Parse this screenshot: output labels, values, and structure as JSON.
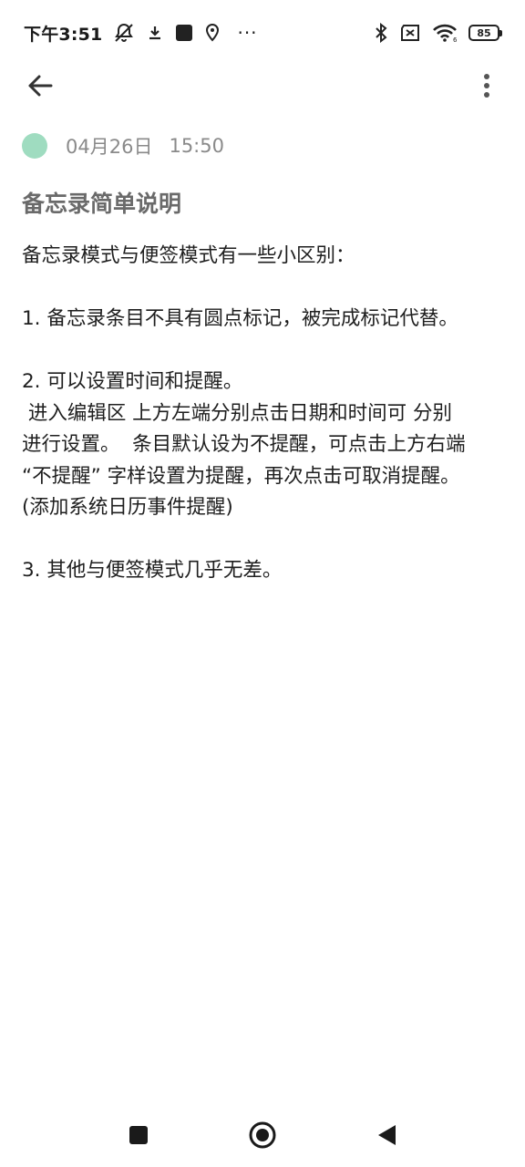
{
  "status_bar": {
    "time": "下午3:51",
    "battery_level": "85",
    "icons": [
      "notifications-off-icon",
      "download-icon",
      "square-icon",
      "location-icon",
      "more-dots-icon",
      "bluetooth-icon",
      "sim-off-icon",
      "wifi-icon",
      "battery-icon"
    ],
    "more": "···"
  },
  "toolbar": {
    "back_icon": "arrow-left-icon",
    "menu_icon": "more-vertical-icon"
  },
  "meta": {
    "color": "#9fdcc0",
    "date": "04月26日",
    "time": "15:50"
  },
  "note": {
    "title": "备忘录简单说明",
    "lines": [
      "备忘录模式与便签模式有一些小区别：",
      "",
      "1. 备忘录条目不具有圆点标记，被完成标记代替。",
      "",
      "2. 可以设置时间和提醒。",
      " 进入编辑区 上方左端分别点击日期和时间可 分别",
      "进行设置。  条目默认设为不提醒，可点击上方右端",
      "“不提醒” 字样设置为提醒，再次点击可取消提醒。",
      "(添加系统日历事件提醒)",
      "",
      "3. 其他与便签模式几乎无差。"
    ]
  },
  "nav_bar": {
    "icons": [
      "recents-square-icon",
      "home-circle-icon",
      "back-triangle-icon"
    ]
  }
}
